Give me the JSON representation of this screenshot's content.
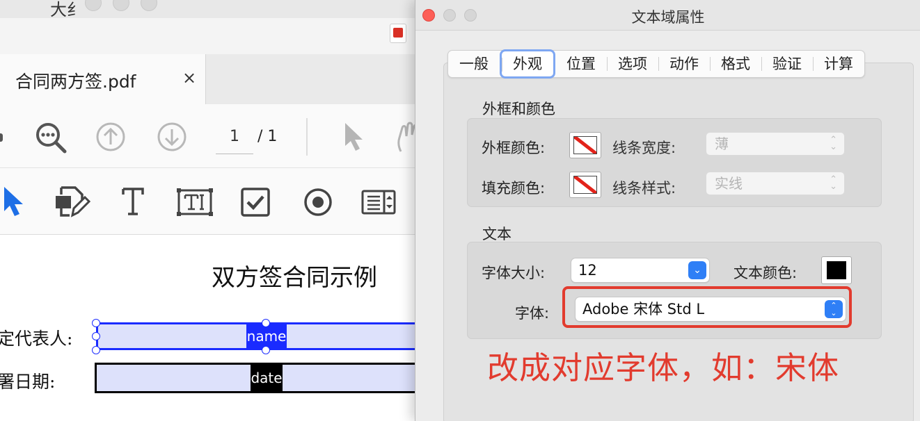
{
  "background_window": {
    "title_fragment": "大纟",
    "tab_label": "合同两方签.pdf",
    "tab_close": "×",
    "page_current": "1",
    "page_total": "/ 1",
    "document": {
      "heading": "双方签合同示例",
      "label_representative": "定代表人:",
      "label_date": "署日期:",
      "field_name": "name",
      "field_date": "date"
    }
  },
  "dialog": {
    "title": "文本域属性",
    "tabs": [
      {
        "label": "一般"
      },
      {
        "label": "外观",
        "active": true
      },
      {
        "label": "位置"
      },
      {
        "label": "选项"
      },
      {
        "label": "动作"
      },
      {
        "label": "格式"
      },
      {
        "label": "验证"
      },
      {
        "label": "计算"
      }
    ],
    "border_section": {
      "title": "外框和颜色",
      "border_color_label": "外框颜色:",
      "fill_color_label": "填充颜色:",
      "line_width_label": "线条宽度:",
      "line_width_value": "薄",
      "line_style_label": "线条样式:",
      "line_style_value": "实线"
    },
    "text_section": {
      "title": "文本",
      "font_size_label": "字体大小:",
      "font_size_value": "12",
      "text_color_label": "文本颜色:",
      "text_color": "#000000",
      "font_label": "字体:",
      "font_value": "Adobe 宋体 Std L"
    }
  },
  "annotation": {
    "text": "改成对应字体，如：宋体",
    "color": "#e23b2e"
  }
}
